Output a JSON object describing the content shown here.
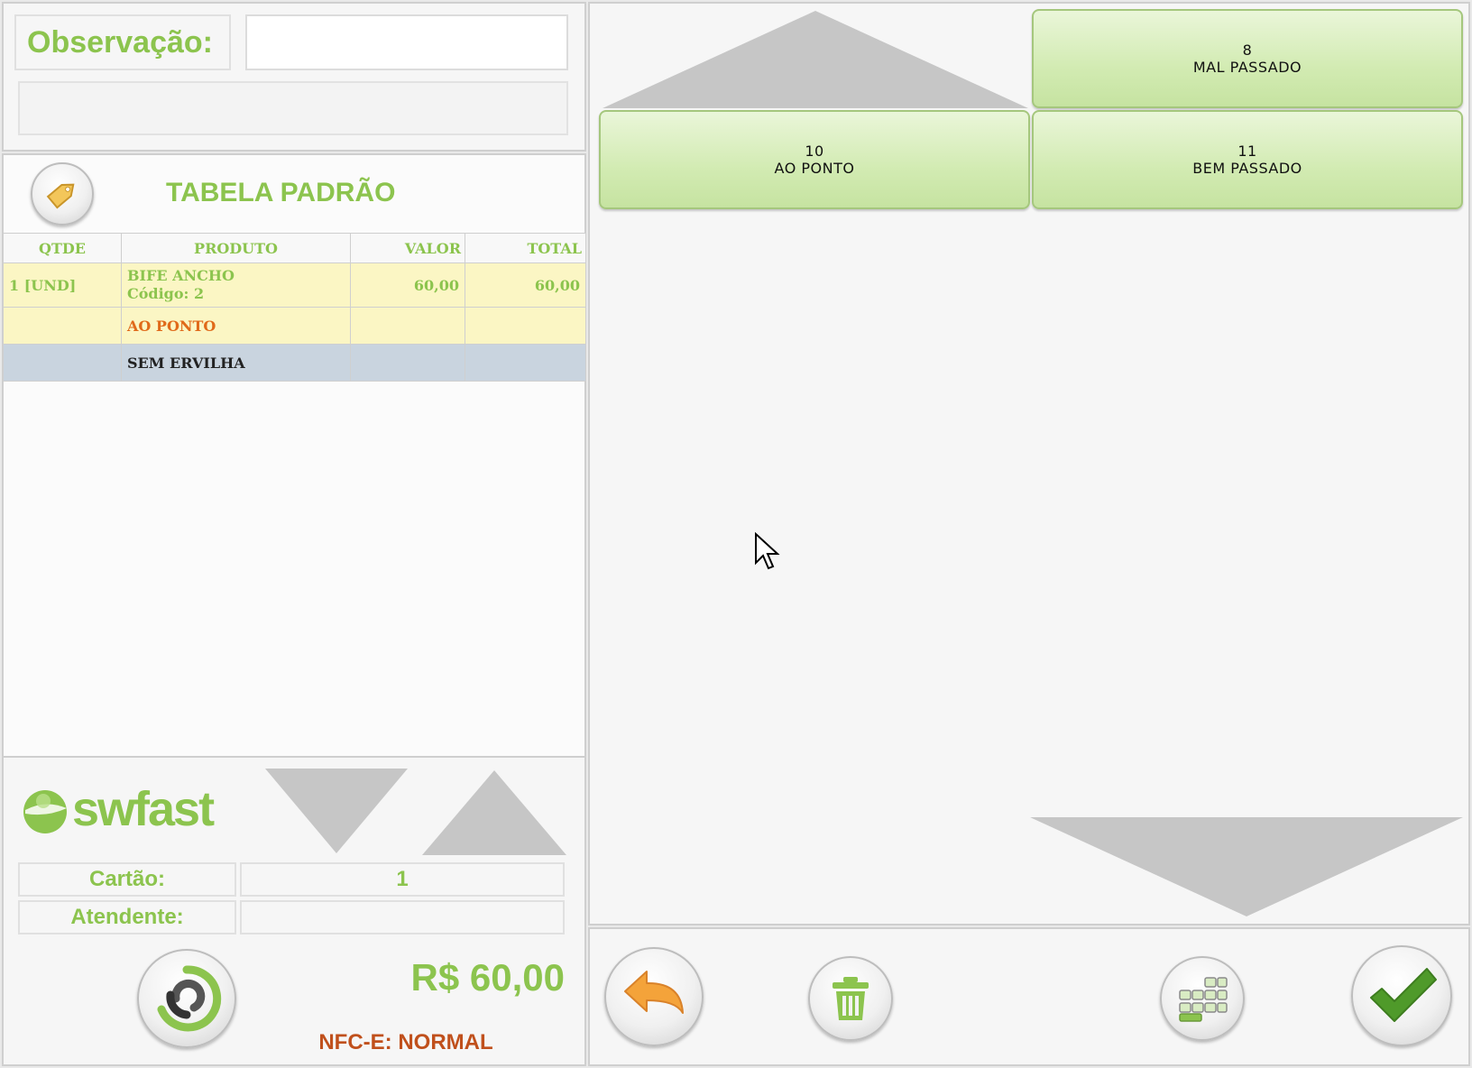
{
  "observacao": {
    "label": "Observação:",
    "value": ""
  },
  "price_table": {
    "title": "TABELA PADRÃO",
    "icon": "price-tag-icon"
  },
  "order_table": {
    "headers": {
      "qtde": "QTDE",
      "produto": "PRODUTO",
      "valor": "VALOR",
      "total": "TOTAL"
    },
    "item": {
      "qtde": "1 [UND]",
      "name": "BIFE ANCHO",
      "code": "Código: 2",
      "valor": "60,00",
      "total": "60,00"
    },
    "modifiers": [
      {
        "text": "AO PONTO",
        "color": "#e06a1a"
      },
      {
        "text": "SEM ERVILHA",
        "selected": true
      }
    ]
  },
  "brand": {
    "name": "swfast",
    "accent": "#8cc44e"
  },
  "info": {
    "cartao_label": "Cartão:",
    "cartao_value": "1",
    "atendente_label": "Atendente:",
    "atendente_value": ""
  },
  "total": {
    "value": "R$ 60,00",
    "nfce": "NFC-E: NORMAL",
    "nfce_color": "#c0501c"
  },
  "options": [
    {
      "number": "8",
      "label": "MAL PASSADO"
    },
    {
      "number": "10",
      "label": "AO PONTO"
    },
    {
      "number": "11",
      "label": "BEM PASSADO"
    }
  ],
  "actions": {
    "back": "undo-arrow-icon",
    "delete": "trash-icon",
    "keyboard": "keyboard-icon",
    "confirm": "checkmark-icon"
  },
  "colors": {
    "green": "#8cc44e",
    "option_bg": "#d2ebb2",
    "selected_row": "#c9d4df",
    "highlight_row": "#fbf6c4"
  }
}
